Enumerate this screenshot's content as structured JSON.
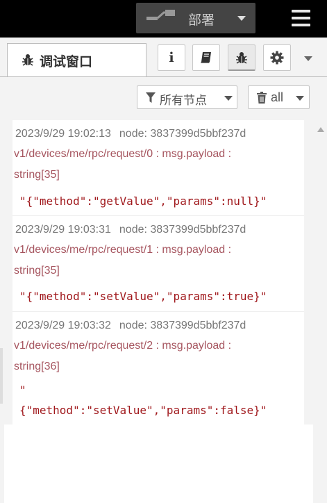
{
  "header": {
    "deploy_label": "部署"
  },
  "sidebar": {
    "tab_label": "调试窗口",
    "tab_buttons": [
      {
        "icon": "info-icon",
        "glyph": "i"
      },
      {
        "icon": "book-icon"
      },
      {
        "icon": "bug-icon",
        "active": true
      },
      {
        "icon": "gear-icon"
      }
    ]
  },
  "filter": {
    "nodes_label": "所有节点",
    "scope_label": "all"
  },
  "messages": [
    {
      "timestamp": "2023/9/29 19:02:13",
      "node": "node: 3837399d5bbf237d",
      "topic_line1": "v1/devices/me/rpc/request/0 : msg.payload :",
      "topic_line2": "string[35]",
      "payload": "\"{\"method\":\"getValue\",\"params\":null}\""
    },
    {
      "timestamp": "2023/9/29 19:03:31",
      "node": "node: 3837399d5bbf237d",
      "topic_line1": "v1/devices/me/rpc/request/1 : msg.payload :",
      "topic_line2": "string[35]",
      "payload": "\"{\"method\":\"setValue\",\"params\":true}\""
    },
    {
      "timestamp": "2023/9/29 19:03:32",
      "node": "node: 3837399d5bbf237d",
      "topic_line1": "v1/devices/me/rpc/request/2 : msg.payload :",
      "topic_line2": "string[36]",
      "payload_line1": "\"",
      "payload_line2": "{\"method\":\"setValue\",\"params\":false}\""
    }
  ]
}
